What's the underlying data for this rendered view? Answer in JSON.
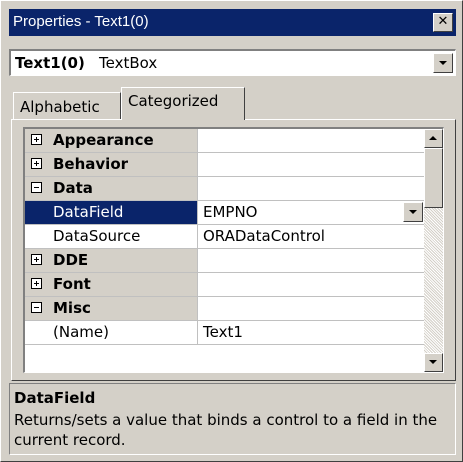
{
  "window": {
    "title": "Properties - Text1(0)"
  },
  "object_selector": {
    "name": "Text1(0)",
    "type": "TextBox"
  },
  "tabs": [
    {
      "label": "Alphabetic",
      "selected": false
    },
    {
      "label": "Categorized",
      "selected": true
    }
  ],
  "grid": {
    "rows": [
      {
        "kind": "category",
        "label": "Appearance",
        "expander": "plus",
        "value": ""
      },
      {
        "kind": "category",
        "label": "Behavior",
        "expander": "plus",
        "value": ""
      },
      {
        "kind": "category",
        "label": "Data",
        "expander": "minus",
        "value": ""
      },
      {
        "kind": "property",
        "label": "DataField",
        "value": "EMPNO",
        "selected": true,
        "has_dropdown": true
      },
      {
        "kind": "property",
        "label": "DataSource",
        "value": "ORADataControl"
      },
      {
        "kind": "category",
        "label": "DDE",
        "expander": "plus",
        "value": ""
      },
      {
        "kind": "category",
        "label": "Font",
        "expander": "plus",
        "value": ""
      },
      {
        "kind": "category",
        "label": "Misc",
        "expander": "minus",
        "value": ""
      },
      {
        "kind": "property",
        "label": "(Name)",
        "value": "Text1"
      }
    ]
  },
  "description": {
    "title": "DataField",
    "text": "Returns/sets a value that binds a control to a field in the current record."
  },
  "icons": {
    "close": "close-icon",
    "combo": "chevron-down-icon",
    "expand": "plus-box-icon",
    "collapse": "minus-box-icon",
    "scroll_up": "chevron-up-icon",
    "scroll_down": "chevron-down-icon"
  },
  "colors": {
    "titlebar": "#0a246a",
    "selection": "#0a246a",
    "face": "#d4d0c8"
  }
}
